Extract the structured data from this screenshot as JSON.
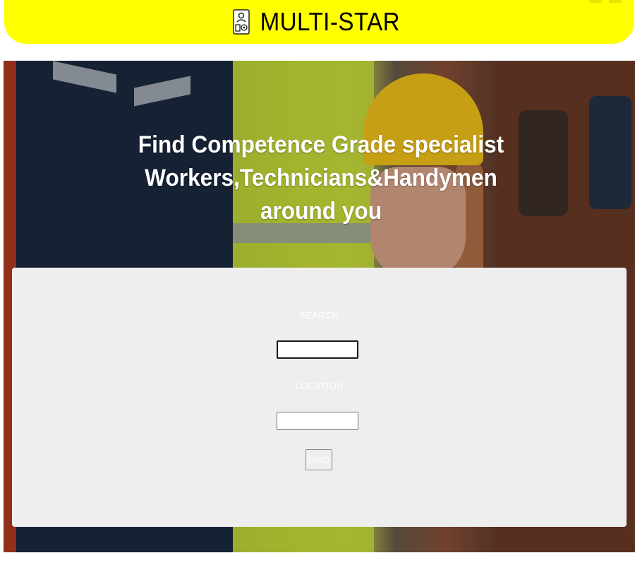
{
  "header": {
    "brand_name": "MULTI-STAR",
    "logo_icon": "tools-worker-icon",
    "background_color": "#ffff00"
  },
  "hero": {
    "headline_lines": [
      "Find Competence Grade specialist",
      "Workers,Technicians&Handymen",
      "around you"
    ]
  },
  "search_form": {
    "search_label": "SEARCH",
    "search_value": "",
    "location_label": "LOCATION",
    "location_value": "",
    "find_button_label": "FIND",
    "panel_color": "#eeeeee"
  }
}
